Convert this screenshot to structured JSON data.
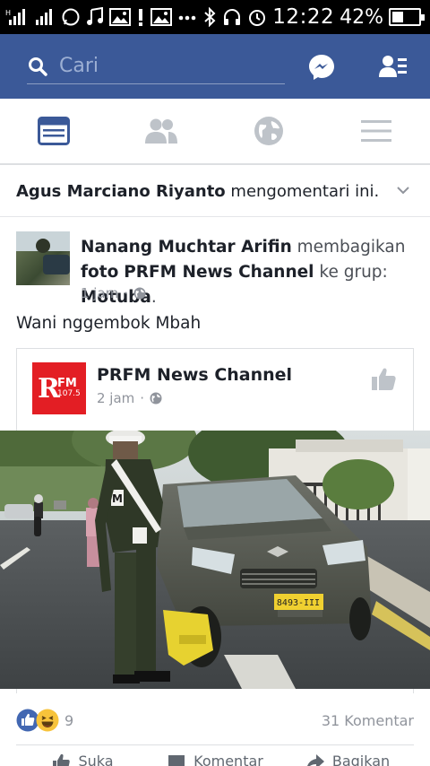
{
  "status_bar": {
    "time": "12:22",
    "battery_percent": "42%",
    "battery_level": 0.42
  },
  "header": {
    "search_placeholder": "Cari",
    "icons": [
      "search-icon",
      "messenger-icon",
      "friend-requests-icon"
    ]
  },
  "tabs": [
    {
      "name": "news-feed",
      "icon": "news-feed-icon",
      "active": true
    },
    {
      "name": "friends",
      "icon": "friends-icon",
      "active": false
    },
    {
      "name": "notifications",
      "icon": "globe-icon",
      "active": false
    },
    {
      "name": "menu",
      "icon": "menu-icon",
      "active": false
    }
  ],
  "activity": {
    "actor": "Agus Marciano Riyanto",
    "action": " mengomentari ini."
  },
  "post": {
    "author": "Nanang Muchtar Arifin",
    "verb": " membagikan ",
    "object": "foto",
    "source": "PRFM News Channel",
    "to_group": " ke grup: ",
    "group": "Motuba",
    "period": ".",
    "time": "1 jam",
    "separator": "·",
    "text": "Wani nggembok Mbah"
  },
  "shared": {
    "page_name": "PRFM News Channel",
    "time": "2 jam",
    "separator": "·",
    "logo_r": "R",
    "logo_fm": "FM",
    "logo_freq": "107.5",
    "plate": "8493-III"
  },
  "footer": {
    "reaction_count": "9",
    "comments": "31 Komentar",
    "actions": [
      "Suka",
      "Komentar",
      "Bagikan"
    ]
  },
  "colors": {
    "brand": "#3b5998",
    "active_tab": "#3b5998",
    "inactive_tab": "#bec3c9",
    "logo_red": "#e31e24"
  }
}
